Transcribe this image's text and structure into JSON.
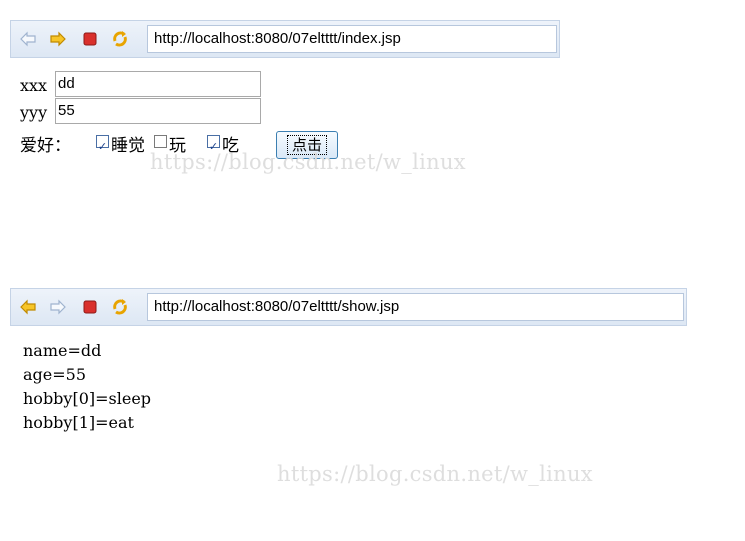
{
  "browser1": {
    "url": "http://localhost:8080/07eltttt/index.jsp",
    "icons": [
      "back-arrow-icon",
      "forward-arrow-icon",
      "stop-icon",
      "refresh-icon"
    ]
  },
  "form": {
    "name_label": "xxx",
    "name_value": "dd",
    "age_label": "yyy",
    "age_value": "55",
    "hobby_label": "爱好：",
    "hobbies": [
      {
        "label": "睡觉",
        "checked": true
      },
      {
        "label": "玩",
        "checked": false
      },
      {
        "label": "吃",
        "checked": true
      }
    ],
    "submit_label": "点击"
  },
  "watermark": "https://blog.csdn.net/w_linux",
  "browser2": {
    "url": "http://localhost:8080/07eltttt/show.jsp"
  },
  "output": {
    "lines": [
      "name=dd",
      "age=55",
      "hobby[0]=sleep",
      "hobby[1]=eat"
    ]
  },
  "colors": {
    "accent": "#e8a400",
    "stop": "#d9302c",
    "toolbar": "#dde7f4"
  }
}
